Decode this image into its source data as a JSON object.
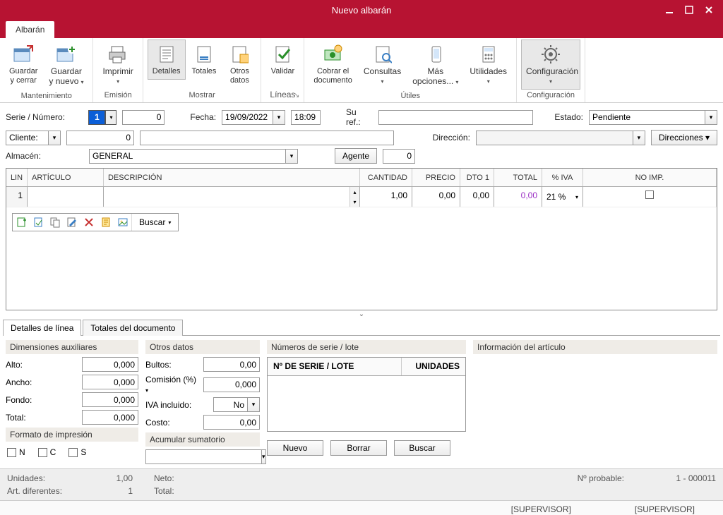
{
  "window": {
    "title": "Nuevo albarán"
  },
  "tabs": {
    "main": "Albarán"
  },
  "ribbon": {
    "maintenance": {
      "label": "Mantenimiento",
      "save_close": "Guardar\ny cerrar",
      "save_new": "Guardar\ny nuevo"
    },
    "emission": {
      "label": "Emisión",
      "print": "Imprimir"
    },
    "show": {
      "label": "Mostrar",
      "details": "Detalles",
      "totals": "Totales",
      "other_data": "Otros\ndatos"
    },
    "lines": {
      "label": "Líneas",
      "validate": "Validar"
    },
    "utils": {
      "label": "Útiles",
      "charge": "Cobrar el\ndocumento",
      "queries": "Consultas",
      "more": "Más\nopciones...",
      "utilities": "Utilidades"
    },
    "config": {
      "label": "Configuración",
      "config": "Configuración"
    }
  },
  "form": {
    "serie_label": "Serie / Número:",
    "serie_value": "1",
    "numero_value": "0",
    "fecha_label": "Fecha:",
    "fecha_value": "19/09/2022",
    "hora_value": "18:09",
    "su_ref_label": "Su ref.:",
    "su_ref_value": "",
    "estado_label": "Estado:",
    "estado_value": "Pendiente",
    "cliente_label": "Cliente:",
    "cliente_code": "0",
    "cliente_name": "",
    "direccion_label": "Dirección:",
    "direccion_value": "",
    "direcciones_btn": "Direcciones",
    "almacen_label": "Almacén:",
    "almacen_value": "GENERAL",
    "agente_btn": "Agente",
    "agente_value": "0"
  },
  "grid": {
    "headers": {
      "lin": "LIN",
      "articulo": "ARTÍCULO",
      "descripcion": "DESCRIPCIÓN",
      "cantidad": "CANTIDAD",
      "precio": "PRECIO",
      "dto1": "DTO 1",
      "total": "TOTAL",
      "iva": "% IVA",
      "noimp": "NO IMP."
    },
    "rows": [
      {
        "lin": "1",
        "articulo": "",
        "descripcion": "",
        "cantidad": "1,00",
        "precio": "0,00",
        "dto1": "0,00",
        "total": "0,00",
        "iva": "21 %"
      }
    ],
    "toolbar_search": "Buscar"
  },
  "detail_tabs": {
    "lines": "Detalles de línea",
    "totals": "Totales del documento"
  },
  "details": {
    "dims_title": "Dimensiones auxiliares",
    "alto": "Alto:",
    "alto_v": "0,000",
    "ancho": "Ancho:",
    "ancho_v": "0,000",
    "fondo": "Fondo:",
    "fondo_v": "0,000",
    "total": "Total:",
    "total_v": "0,000",
    "fmt_title": "Formato de impresión",
    "fmt_n": "N",
    "fmt_c": "C",
    "fmt_s": "S",
    "other_title": "Otros datos",
    "bultos": "Bultos:",
    "bultos_v": "0,00",
    "comision": "Comisión (%)",
    "comision_v": "0,000",
    "iva_inc": "IVA incluido:",
    "iva_inc_v": "No",
    "costo": "Costo:",
    "costo_v": "0,00",
    "acum_title": "Acumular sumatorio",
    "serie_title": "Números de serie / lote",
    "serie_h1": "Nº DE SERIE / LOTE",
    "serie_h2": "UNIDADES",
    "nuevo": "Nuevo",
    "borrar": "Borrar",
    "buscar": "Buscar",
    "info_title": "Información del artículo"
  },
  "footer": {
    "unidades_l": "Unidades:",
    "unidades_v": "1,00",
    "neto_l": "Neto:",
    "art_dif_l": "Art. diferentes:",
    "art_dif_v": "1",
    "total_l": "Total:",
    "probable_l": "Nº probable:",
    "probable_v": "1 - 000011"
  },
  "status": {
    "user1": "[SUPERVISOR]",
    "user2": "[SUPERVISOR]"
  }
}
